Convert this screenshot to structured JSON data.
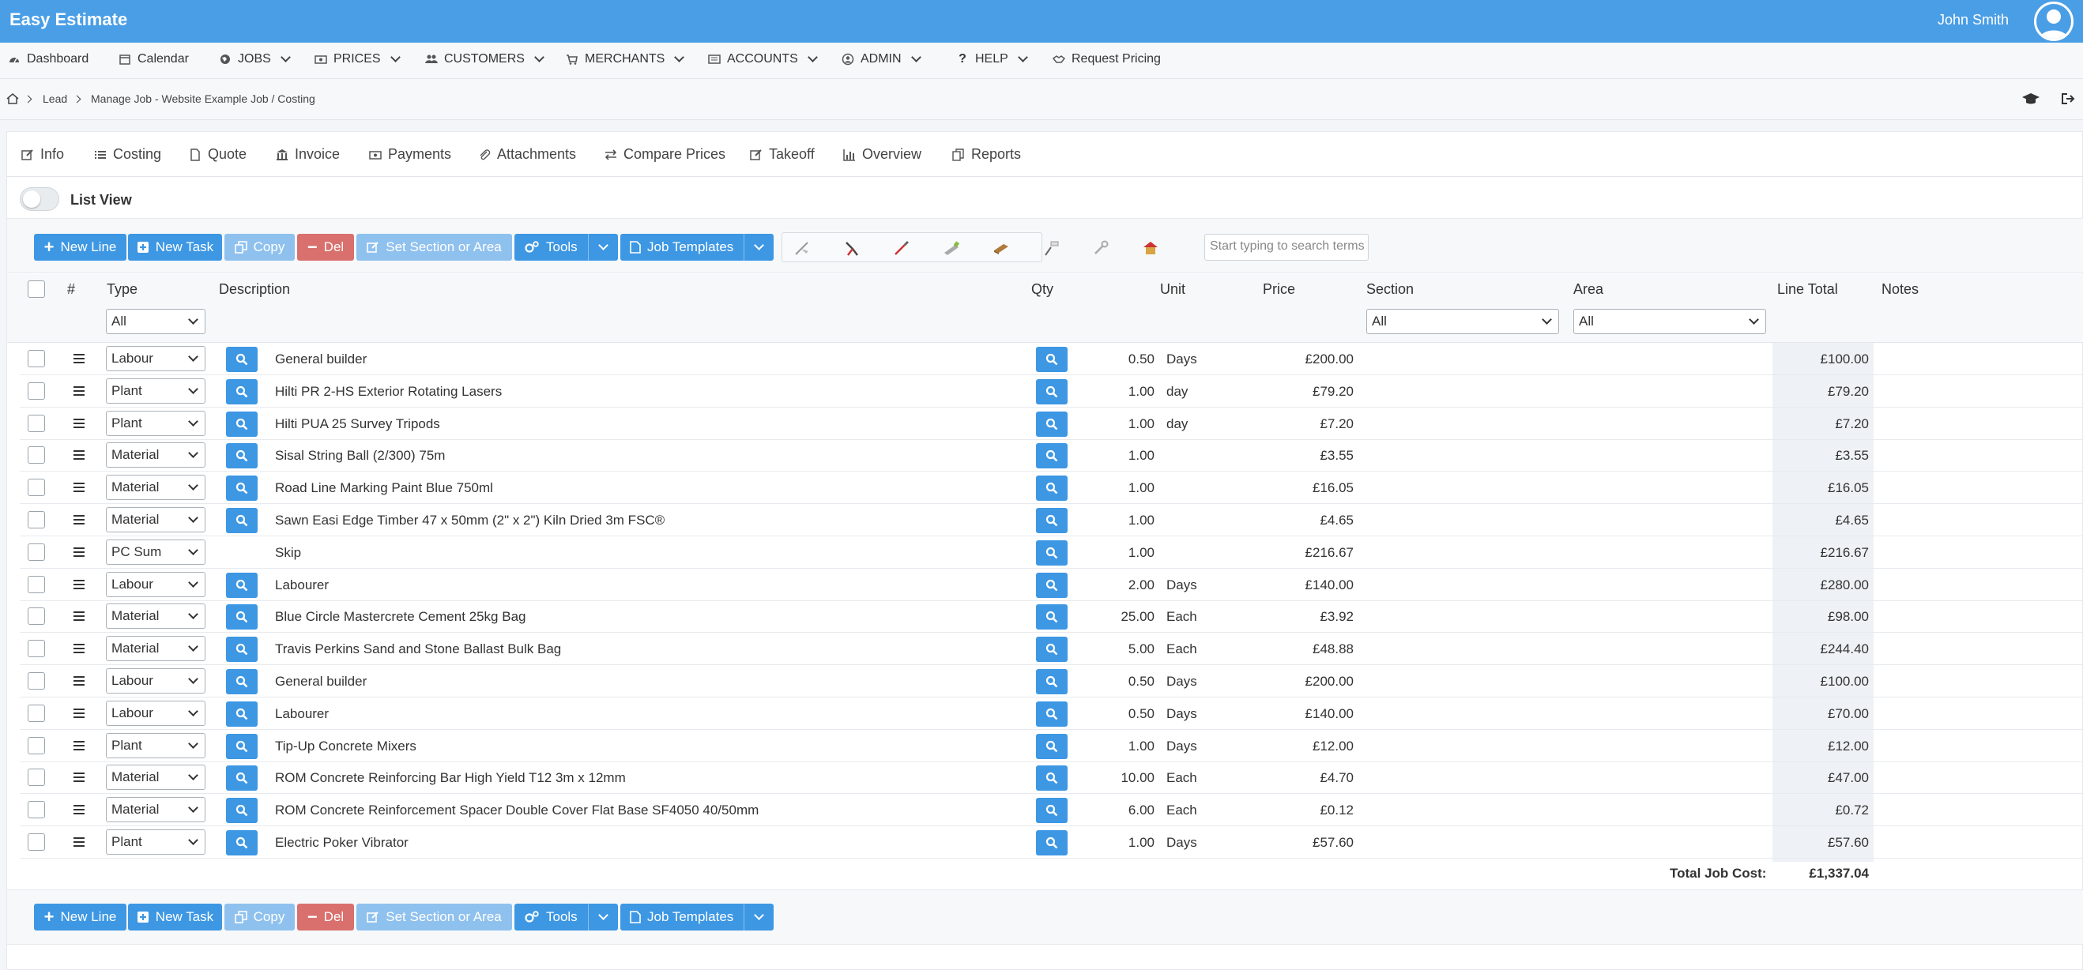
{
  "app": {
    "title": "Easy Estimate",
    "user_name": "John Smith"
  },
  "nav": [
    {
      "label": "Dashboard",
      "icon": "dashboard-icon"
    },
    {
      "label": "Calendar",
      "icon": "calendar-icon"
    },
    {
      "label": "JOBS",
      "icon": "globe-icon"
    },
    {
      "label": "PRICES",
      "icon": "money-icon"
    },
    {
      "label": "CUSTOMERS",
      "icon": "users-icon"
    },
    {
      "label": "MERCHANTS",
      "icon": "cart-icon"
    },
    {
      "label": "ACCOUNTS",
      "icon": "ledger-icon"
    },
    {
      "label": "ADMIN",
      "icon": "user-circle-icon"
    },
    {
      "label": "HELP",
      "icon": "question-icon"
    },
    {
      "label": "Request Pricing",
      "icon": "handshake-icon"
    }
  ],
  "breadcrumb": {
    "lead": "Lead",
    "current": "Manage Job - Website Example Job / Costing"
  },
  "tabs": [
    "Info",
    "Costing",
    "Quote",
    "Invoice",
    "Payments",
    "Attachments",
    "Compare Prices",
    "Takeoff",
    "Overview",
    "Reports"
  ],
  "list_view_label": "List View",
  "toolbar": {
    "new_line": "New Line",
    "new_task": "New Task",
    "copy": "Copy",
    "del": "Del",
    "set_section": "Set Section or Area",
    "tools": "Tools",
    "job_templates": "Job Templates",
    "search_placeholder": "Start typing to search terms"
  },
  "columns": {
    "num": "#",
    "type": "Type",
    "description": "Description",
    "qty": "Qty",
    "unit": "Unit",
    "price": "Price",
    "section": "Section",
    "area": "Area",
    "line_total": "Line Total",
    "notes": "Notes"
  },
  "filters": {
    "type": "All",
    "section": "All",
    "area": "All"
  },
  "rows": [
    {
      "type": "Labour",
      "desc": "General builder",
      "qty": "0.50",
      "unit": "Days",
      "price": "£200.00",
      "total": "£100.00",
      "desc_search": true
    },
    {
      "type": "Plant",
      "desc": "Hilti PR 2-HS Exterior Rotating Lasers",
      "qty": "1.00",
      "unit": "day",
      "price": "£79.20",
      "total": "£79.20",
      "desc_search": true
    },
    {
      "type": "Plant",
      "desc": "Hilti PUA 25 Survey Tripods",
      "qty": "1.00",
      "unit": "day",
      "price": "£7.20",
      "total": "£7.20",
      "desc_search": true
    },
    {
      "type": "Material",
      "desc": "Sisal String Ball (2/300) 75m",
      "qty": "1.00",
      "unit": "",
      "price": "£3.55",
      "total": "£3.55",
      "desc_search": true
    },
    {
      "type": "Material",
      "desc": "Road Line Marking Paint Blue 750ml",
      "qty": "1.00",
      "unit": "",
      "price": "£16.05",
      "total": "£16.05",
      "desc_search": true
    },
    {
      "type": "Material",
      "desc": "Sawn Easi Edge Timber 47 x 50mm (2\" x 2\") Kiln Dried 3m FSC®",
      "qty": "1.00",
      "unit": "",
      "price": "£4.65",
      "total": "£4.65",
      "desc_search": true
    },
    {
      "type": "PC Sum",
      "desc": "Skip",
      "qty": "1.00",
      "unit": "",
      "price": "£216.67",
      "total": "£216.67",
      "desc_search": false
    },
    {
      "type": "Labour",
      "desc": "Labourer",
      "qty": "2.00",
      "unit": "Days",
      "price": "£140.00",
      "total": "£280.00",
      "desc_search": true
    },
    {
      "type": "Material",
      "desc": "Blue Circle Mastercrete Cement 25kg Bag",
      "qty": "25.00",
      "unit": "Each",
      "price": "£3.92",
      "total": "£98.00",
      "desc_search": true
    },
    {
      "type": "Material",
      "desc": "Travis Perkins Sand and Stone Ballast Bulk Bag",
      "qty": "5.00",
      "unit": "Each",
      "price": "£48.88",
      "total": "£244.40",
      "desc_search": true
    },
    {
      "type": "Labour",
      "desc": "General builder",
      "qty": "0.50",
      "unit": "Days",
      "price": "£200.00",
      "total": "£100.00",
      "desc_search": true
    },
    {
      "type": "Labour",
      "desc": "Labourer",
      "qty": "0.50",
      "unit": "Days",
      "price": "£140.00",
      "total": "£70.00",
      "desc_search": true
    },
    {
      "type": "Plant",
      "desc": "Tip-Up Concrete Mixers",
      "qty": "1.00",
      "unit": "Days",
      "price": "£12.00",
      "total": "£12.00",
      "desc_search": true
    },
    {
      "type": "Material",
      "desc": "ROM Concrete Reinforcing Bar High Yield T12 3m x 12mm",
      "qty": "10.00",
      "unit": "Each",
      "price": "£4.70",
      "total": "£47.00",
      "desc_search": true
    },
    {
      "type": "Material",
      "desc": "ROM Concrete Reinforcement Spacer Double Cover Flat Base SF4050 40/50mm",
      "qty": "6.00",
      "unit": "Each",
      "price": "£0.12",
      "total": "£0.72",
      "desc_search": true
    },
    {
      "type": "Plant",
      "desc": "Electric Poker Vibrator",
      "qty": "1.00",
      "unit": "Days",
      "price": "£57.60",
      "total": "£57.60",
      "desc_search": true
    }
  ],
  "total": {
    "label": "Total Job Cost:",
    "value": "£1,337.04"
  },
  "colors": {
    "brand": "#4a9ee6",
    "button_blue": "#3d97e3",
    "button_light": "#8fc1ee",
    "button_red": "#d9706d"
  }
}
